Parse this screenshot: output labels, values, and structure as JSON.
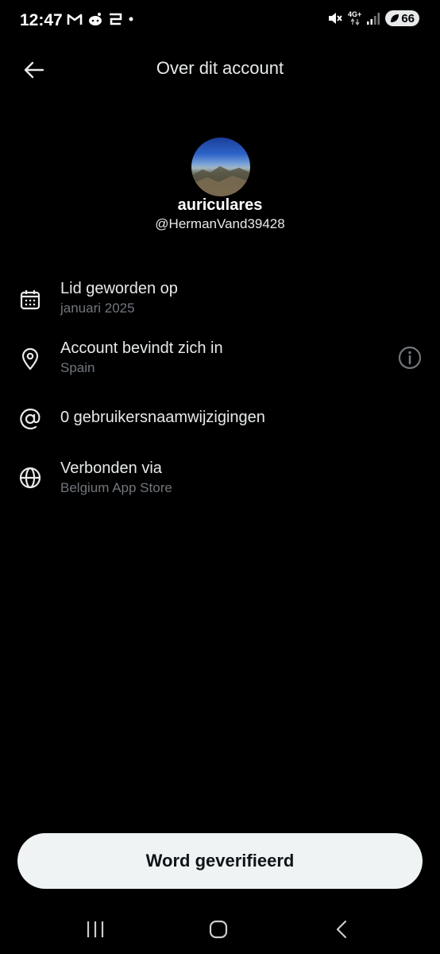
{
  "status_bar": {
    "time": "12:47",
    "network": "4G+",
    "battery": "66"
  },
  "header": {
    "title": "Over dit account"
  },
  "profile": {
    "display_name": "auriculares",
    "handle": "@HermanVand39428"
  },
  "info_rows": [
    {
      "title": "Lid geworden op",
      "subtitle": "januari 2025",
      "icon": "calendar-icon"
    },
    {
      "title": "Account bevindt zich in",
      "subtitle": "Spain",
      "icon": "location-pin-icon"
    },
    {
      "title": "0 gebruikersnaamwijzigingen",
      "icon": "at-sign-icon"
    },
    {
      "title": "Verbonden via",
      "subtitle": "Belgium App Store",
      "icon": "globe-icon"
    }
  ],
  "cta": {
    "label": "Word geverifieerd"
  },
  "colors": {
    "background": "#000000",
    "text_primary": "#e7e9ea",
    "text_secondary": "#71767b",
    "button_bg": "#eff3f4",
    "button_text": "#0f1419"
  }
}
